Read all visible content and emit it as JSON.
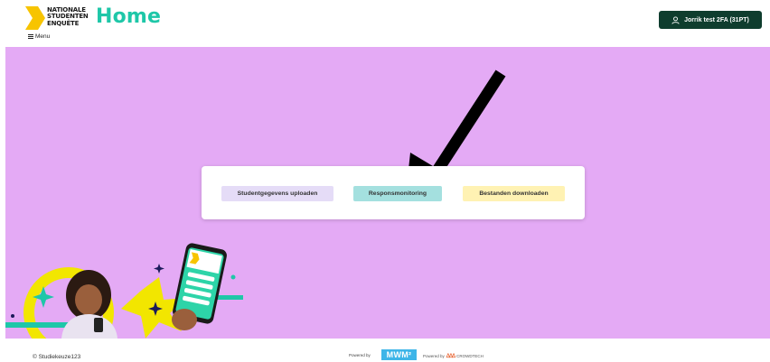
{
  "header": {
    "logo_lines": [
      "NATIONALE",
      "STUDENTEN",
      "ENQUÊTE"
    ],
    "title": "Home",
    "menu_label": "Menu",
    "user_button_label": "Jorrik test 2FA (31PT)"
  },
  "main": {
    "actions": [
      {
        "label": "Studentgegevens uploaden"
      },
      {
        "label": "Responsmonitoring"
      },
      {
        "label": "Bestanden downloaden"
      }
    ]
  },
  "footer": {
    "copyright": "© Studiekeuze123",
    "powered_by_1": "Powered by",
    "mwm_logo": "MWM²",
    "powered_by_2": "Powered by",
    "crowdtech": "CROWDTECH"
  },
  "colors": {
    "accent": "#1ec7a8",
    "background": "#e4aaf5",
    "user_button": "#0f3d2e"
  }
}
